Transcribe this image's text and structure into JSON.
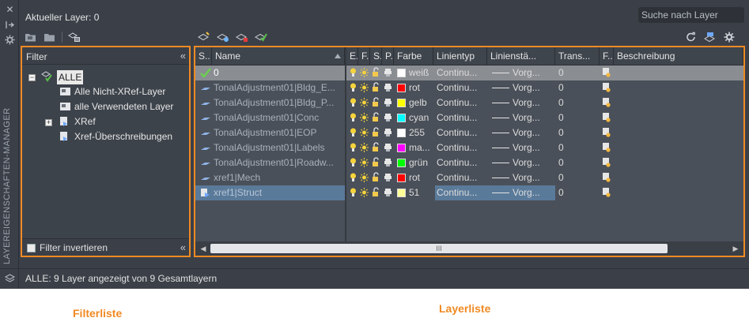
{
  "panel": {
    "vertical_title": "LAYEREIGENSCHAFTEN-MANAGER",
    "current_layer": "Aktueller Layer: 0",
    "search_placeholder": "Suche nach Layer",
    "status": "ALLE: 9 Layer angezeigt von 9 Gesamtlayern"
  },
  "filter": {
    "title": "Filter",
    "collapse_glyph": "«",
    "tree": {
      "root_toggle": "−",
      "root": "ALLE",
      "items": [
        "Alle Nicht-XRef-Layer",
        "alle Verwendeten Layer",
        "XRef",
        "Xref-Überschreibungen"
      ],
      "xref_toggle": "+"
    },
    "invert_label": "Filter invertieren"
  },
  "columns": [
    "S..",
    "Name",
    "E..",
    "F..",
    "S..",
    "P..",
    "Farbe",
    "Linientyp",
    "Linienstä...",
    "Trans...",
    "F..",
    "Beschreibung"
  ],
  "layers": [
    {
      "name": "0",
      "color_name": "weiß",
      "color": "#ffffff",
      "linetype": "Continu...",
      "lineweight": "Vorg...",
      "transparency": "0",
      "state": "current"
    },
    {
      "name": "TonalAdjustment01|Bldg_E...",
      "color_name": "rot",
      "color": "#ff0000",
      "linetype": "Continu...",
      "lineweight": "Vorg...",
      "transparency": "0",
      "state": "xref"
    },
    {
      "name": "TonalAdjustment01|Bldg_P...",
      "color_name": "gelb",
      "color": "#ffff00",
      "linetype": "Continu...",
      "lineweight": "Vorg...",
      "transparency": "0",
      "state": "xref"
    },
    {
      "name": "TonalAdjustment01|Conc",
      "color_name": "cyan",
      "color": "#00ffff",
      "linetype": "Continu...",
      "lineweight": "Vorg...",
      "transparency": "0",
      "state": "xref"
    },
    {
      "name": "TonalAdjustment01|EOP",
      "color_name": "255",
      "color": "#ffffff",
      "linetype": "Continu...",
      "lineweight": "Vorg...",
      "transparency": "0",
      "state": "xref"
    },
    {
      "name": "TonalAdjustment01|Labels",
      "color_name": "ma...",
      "color": "#ff00ff",
      "linetype": "Continu...",
      "lineweight": "Vorg...",
      "transparency": "0",
      "state": "xref"
    },
    {
      "name": "TonalAdjustment01|Roadw...",
      "color_name": "grün",
      "color": "#00ff00",
      "linetype": "Continu...",
      "lineweight": "Vorg...",
      "transparency": "0",
      "state": "xref"
    },
    {
      "name": "xref1|Mech",
      "color_name": "rot",
      "color": "#ff0000",
      "linetype": "Continu...",
      "lineweight": "Vorg...",
      "transparency": "0",
      "state": "xref"
    },
    {
      "name": "xref1|Struct",
      "color_name": "51",
      "color": "#ffff99",
      "linetype": "Continu...",
      "lineweight": "Vorg...",
      "transparency": "0",
      "state": "selected"
    }
  ],
  "scrollbar_grip": "III",
  "captions": {
    "filter_list": "Filterliste",
    "layer_list": "Layerliste"
  },
  "colors": {
    "highlight": "#f08a24",
    "panel_bg": "#3b4048",
    "selected_row": "#5a7a9a",
    "current_row": "#8a8d92"
  }
}
